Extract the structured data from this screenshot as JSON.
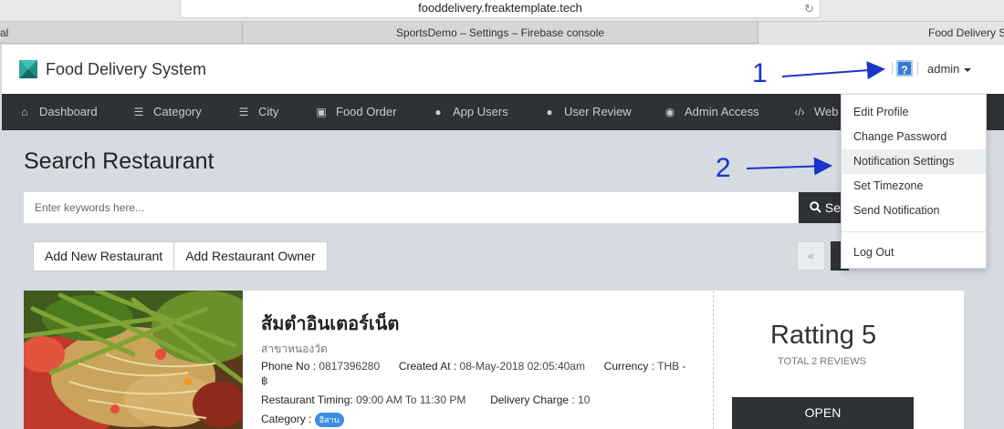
{
  "browser": {
    "url": "fooddelivery.freaktemplate.tech",
    "tabs": [
      {
        "label": "al"
      },
      {
        "label": "SportsDemo – Settings – Firebase console"
      },
      {
        "label": "Food Delivery S"
      }
    ]
  },
  "app": {
    "title": "Food Delivery System",
    "admin_label": "admin",
    "help_glyph": "?"
  },
  "nav": [
    {
      "label": "Dashboard",
      "icon": "home-icon"
    },
    {
      "label": "Category",
      "icon": "list-icon"
    },
    {
      "label": "City",
      "icon": "list-icon"
    },
    {
      "label": "Food Order",
      "icon": "shopping-bag-icon"
    },
    {
      "label": "App Users",
      "icon": "users-icon"
    },
    {
      "label": "User Review",
      "icon": "comment-icon"
    },
    {
      "label": "Admin Access",
      "icon": "user-circle-icon"
    },
    {
      "label": "Web",
      "icon": "code-icon"
    }
  ],
  "dropdown": {
    "items": [
      {
        "label": "Edit Profile"
      },
      {
        "label": "Change Password"
      },
      {
        "label": "Notification Settings"
      },
      {
        "label": "Set Timezone"
      },
      {
        "label": "Send Notification"
      },
      {
        "label": "Log Out"
      }
    ]
  },
  "main": {
    "page_title": "Search Restaurant",
    "search_placeholder": "Enter keywords here...",
    "search_button": "Search",
    "add_restaurant": "Add New Restaurant",
    "add_owner": "Add Restaurant Owner",
    "pager_prev": "«"
  },
  "restaurant": {
    "name": "ส้มตำอินเตอร์เน็ต",
    "branch": "สาขาหนองวัด",
    "phone_label": "Phone No :",
    "phone": "0817396280",
    "created_label": "Created At :",
    "created": "08-May-2018 02:05:40am",
    "currency_label": "Currency :",
    "currency": "THB -",
    "currency_symbol": "฿",
    "timing_label": "Restaurant Timing:",
    "timing": "09:00 AM To 11:30 PM",
    "delivery_label": "Delivery Charge :",
    "delivery": "10",
    "category_label": "Category :",
    "category": "อีสาน",
    "rating": "Ratting 5",
    "reviews": "TOTAL 2 REVIEWS",
    "status_button": "OPEN"
  },
  "annotations": {
    "one": "1",
    "two": "2",
    "color": "#1a35c7"
  },
  "colors": {
    "nav_bg": "#2e3237",
    "page_bg": "#d5dbe1",
    "badge": "#3b8ee0"
  }
}
